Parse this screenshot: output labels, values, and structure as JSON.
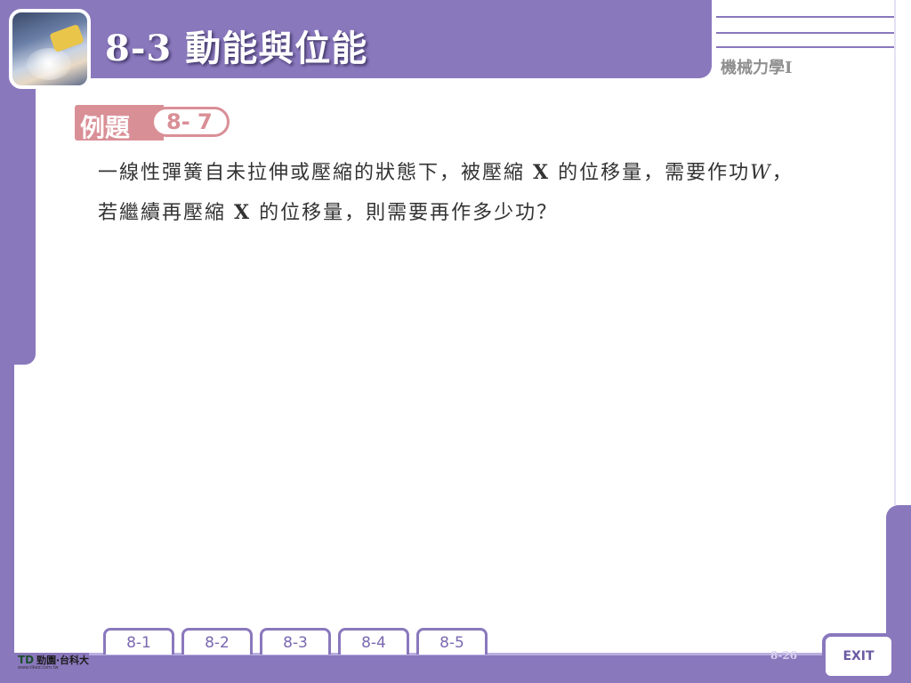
{
  "header": {
    "title": "8-3  動能與位能",
    "subject": "機械力學I"
  },
  "example": {
    "label": "例題",
    "number": "8- 7"
  },
  "question": {
    "line1_a": "一線性彈簧自未拉伸或壓縮的狀態下，被壓縮 ",
    "var_x": "X",
    "line1_b": " 的位移量，需要作功",
    "var_w": "W",
    "line1_c": "，",
    "line2_a": "若繼續再壓縮 ",
    "line2_b": " 的位移量，則需要再作多少功？"
  },
  "tabs": [
    "8-1",
    "8-2",
    "8-3",
    "8-4",
    "8-5"
  ],
  "footer": {
    "logo_mark": "TD",
    "logo_text": "勁園‧台科大",
    "logo_sub": "www.tiked.com.tw",
    "page_number": "8-26",
    "exit_label": "EXIT"
  },
  "colors": {
    "frame": "#8a78bd",
    "badge": "#d98f96"
  }
}
